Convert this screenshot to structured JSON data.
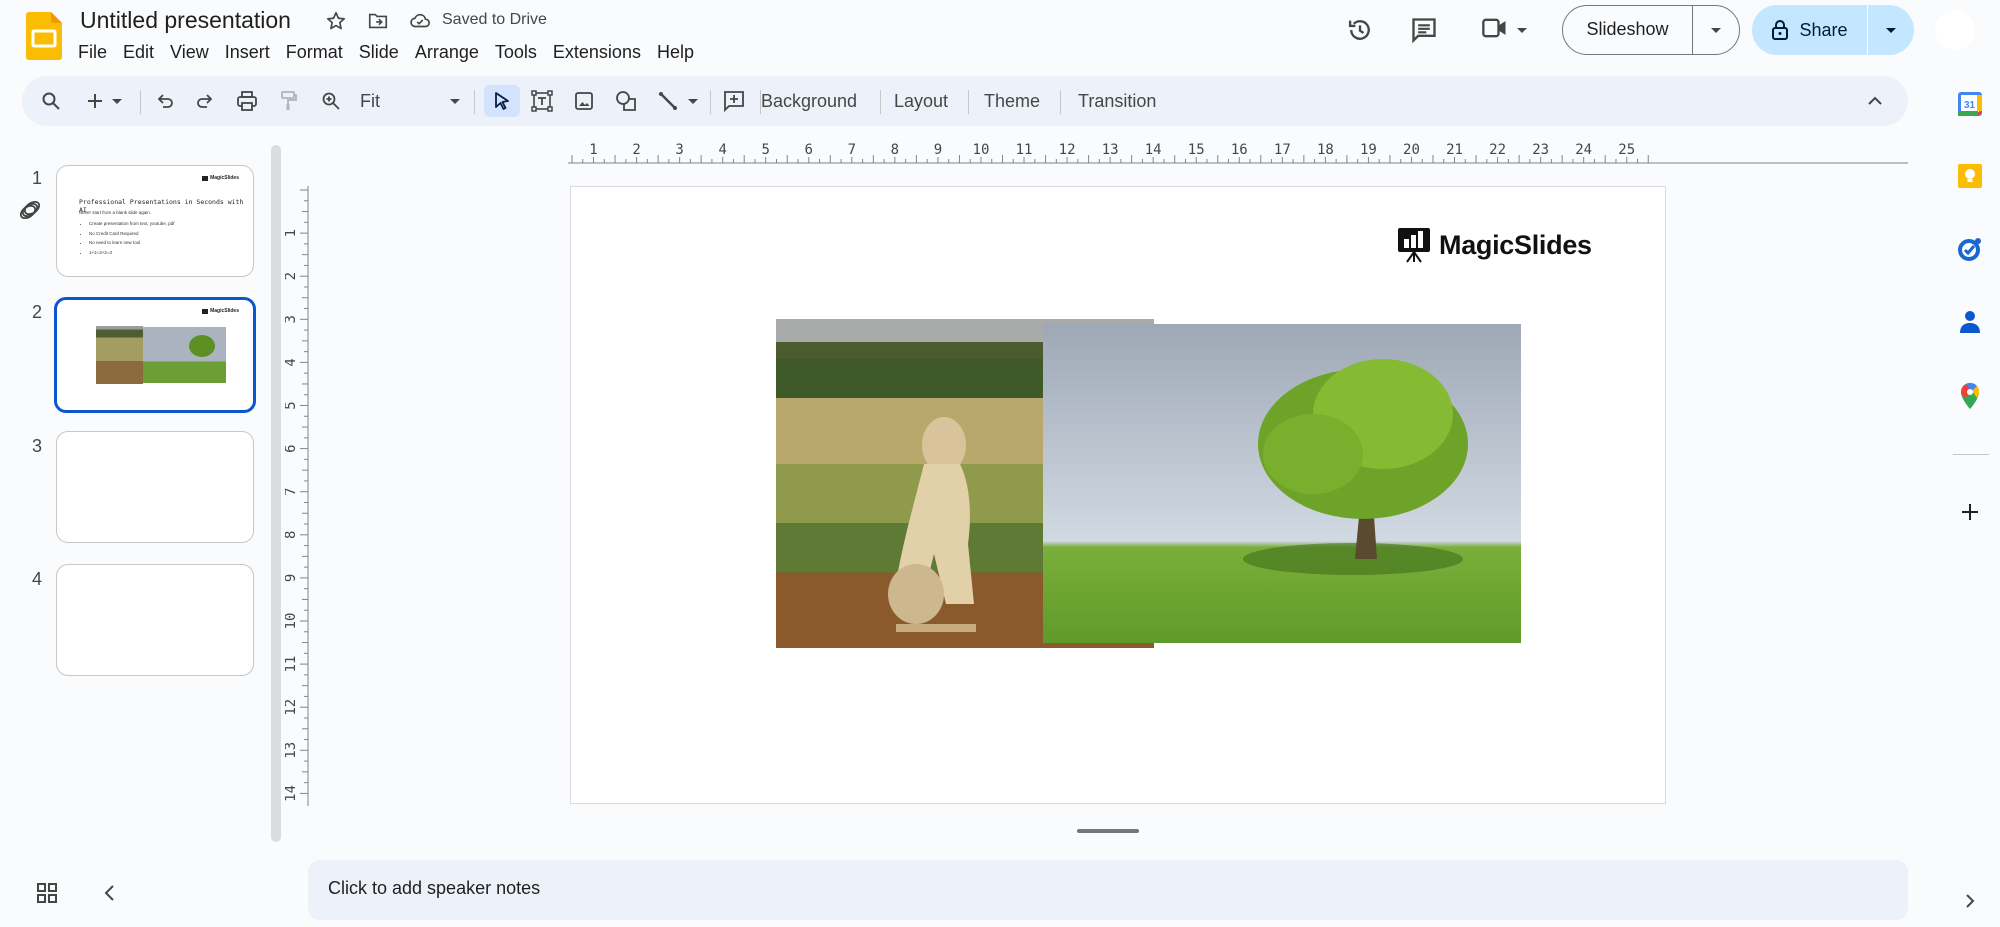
{
  "header": {
    "title": "Untitled presentation",
    "save_status": "Saved to Drive",
    "menu": [
      "File",
      "Edit",
      "View",
      "Insert",
      "Format",
      "Slide",
      "Arrange",
      "Tools",
      "Extensions",
      "Help"
    ],
    "slideshow_label": "Slideshow",
    "share_label": "Share"
  },
  "toolbar": {
    "zoom_value": "Fit",
    "background_label": "Background",
    "layout_label": "Layout",
    "theme_label": "Theme",
    "transition_label": "Transition"
  },
  "filmstrip": {
    "slides": [
      {
        "number": "1",
        "title": "Professional Presentations in Seconds with AI",
        "subtitle": "Never start from a blank slide again.",
        "bullets": [
          "Create presentation from text, youtube, pdf",
          "No Credit Card Required",
          "No need to learn new tool",
          "1+2=3+2=3"
        ],
        "logo": "MagicSlides"
      },
      {
        "number": "2",
        "logo": "MagicSlides",
        "selected": true
      },
      {
        "number": "3"
      },
      {
        "number": "4"
      }
    ]
  },
  "ruler": {
    "horizontal": [
      "1",
      "2",
      "3",
      "4",
      "5",
      "6",
      "7",
      "8",
      "9",
      "10",
      "11",
      "12",
      "13",
      "14",
      "15",
      "16",
      "17",
      "18",
      "19",
      "20",
      "21",
      "22",
      "23",
      "24",
      "25"
    ],
    "vertical": [
      "1",
      "2",
      "3",
      "4",
      "5",
      "6",
      "7",
      "8",
      "9",
      "10",
      "11",
      "12",
      "13",
      "14"
    ]
  },
  "slide": {
    "logo_text": "MagicSlides",
    "images": [
      "lioness in savanna grass",
      "lone green tree on grassy hill"
    ]
  },
  "notes": {
    "placeholder": "Click to add speaker notes"
  },
  "side_panel": {
    "calendar_day": "31",
    "apps": [
      "Calendar",
      "Keep",
      "Tasks",
      "Contacts",
      "Maps"
    ]
  },
  "colors": {
    "accent": "#0b57d0",
    "share_bg": "#c2e7ff",
    "toolbar_bg": "#edf2fa",
    "app_logo": "#fbbc04"
  }
}
